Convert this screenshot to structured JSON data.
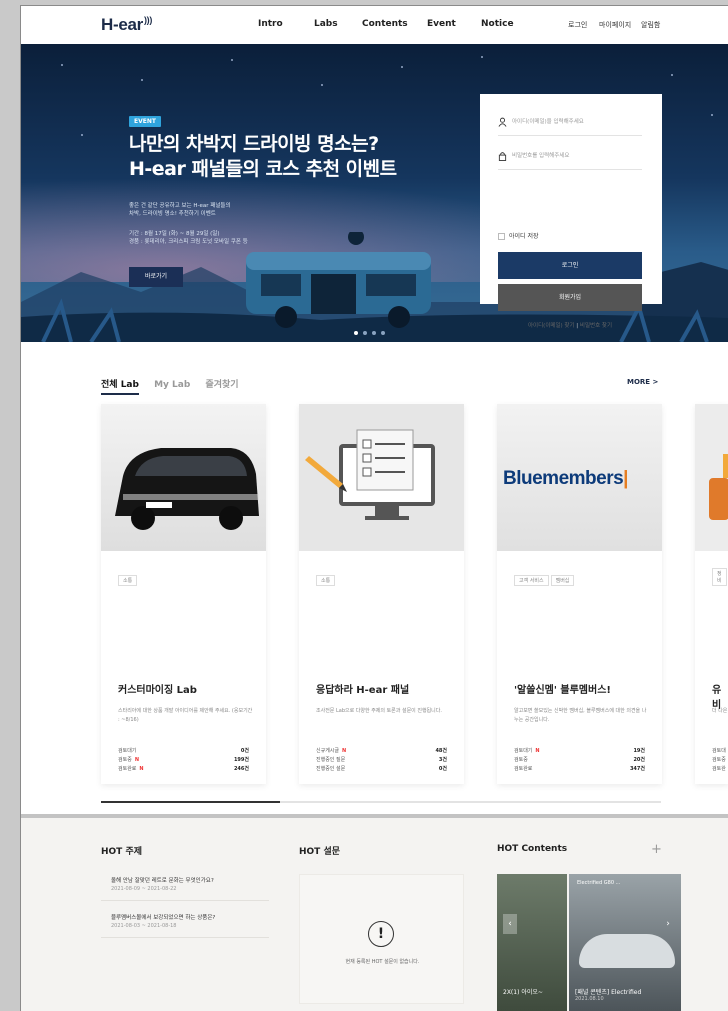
{
  "header": {
    "logo": "H-ear",
    "nav": [
      "Intro",
      "Labs",
      "Contents",
      "Event",
      "Notice"
    ],
    "util": [
      "로그인",
      "마이페이지",
      "알림함"
    ]
  },
  "hero": {
    "badge": "EVENT",
    "title_line1": "나만의 차박지 드라이빙 명소는?",
    "title_line2": "H-ear 패널들의 코스 추천 이벤트",
    "desc_line1": "좋은 건 같단 공유하고 보는 H-ear 패널들의",
    "desc_line2": "차박, 드라이빙 명소! 추천하기 이벤트",
    "period": "기간 : 8월 17일 (화) ~ 8월 29일 (일)",
    "prize": "경품 : 롯데리아, 크리스피 크림 도넛 모바일 쿠폰 등",
    "button": "바로가기",
    "slides": 4,
    "active_slide": 0
  },
  "login": {
    "id_placeholder": "아이디(이메일)을 입력해주세요",
    "pw_placeholder": "비밀번호를 입력해주세요",
    "remember": "아이디 저장",
    "login_button": "로그인",
    "join_button": "회원가입",
    "find_id": "아이디(이메일) 찾기",
    "find_pw": "비밀번호 찾기",
    "primary_color": "#1b3a66",
    "secondary_color": "#555555"
  },
  "labs": {
    "tabs": [
      "전체 Lab",
      "My Lab",
      "즐겨찾기"
    ],
    "active_tab": 0,
    "more": "MORE >",
    "cards": [
      {
        "tags": [
          "소통"
        ],
        "title": "커스터마이징 Lab",
        "desc": "스타리아에 대한 상품 개발 아이디어를 제안해 주세요. (응모기간 : ~8/16)",
        "stats": [
          {
            "label": "검토대기",
            "new": false,
            "value": "0건"
          },
          {
            "label": "검토중",
            "new": true,
            "value": "199건"
          },
          {
            "label": "검토완료",
            "new": true,
            "value": "246건"
          }
        ]
      },
      {
        "tags": [
          "소통"
        ],
        "title": "응답하라 H-ear 패널",
        "desc": "조사전문 Lab으로 다양한 주제의 토론과 설문이 진행됩니다.",
        "stats": [
          {
            "label": "신규게시글",
            "new": true,
            "value": "48건"
          },
          {
            "label": "진행중인 질문",
            "new": false,
            "value": "3건"
          },
          {
            "label": "진행중인 설문",
            "new": false,
            "value": "0건"
          }
        ]
      },
      {
        "tags": [
          "고객 서비스",
          "멤버십"
        ],
        "title": "'알쓸신멤' 블루멤버스!",
        "desc": "알고보면 쓸모있는 신박한 멤버십, 블루멤버스에 대한 의견을 나누는 공간입니다.",
        "stats": [
          {
            "label": "검토대기",
            "new": true,
            "value": "19건"
          },
          {
            "label": "검토중",
            "new": false,
            "value": "20건"
          },
          {
            "label": "검토완료",
            "new": false,
            "value": "347건"
          }
        ]
      },
      {
        "tags": [
          "정비"
        ],
        "title": "유비",
        "desc": "더 나은 ... 들의 ...",
        "stats": [
          {
            "label": "검토대",
            "new": false,
            "value": ""
          },
          {
            "label": "검토중",
            "new": false,
            "value": ""
          },
          {
            "label": "검토완",
            "new": false,
            "value": ""
          }
        ]
      }
    ],
    "bluemembers_logo": "Bluemembers",
    "scroll_progress": 0.32
  },
  "hot": {
    "topics_title": "HOT 주제",
    "topics": [
      {
        "q": "올해 안남 잘맞던 레트로 문화는 무엇인가요?",
        "d": "2021-08-09 ~ 2021-08-22"
      },
      {
        "q": "블루멤버스몰에서 보강되었으면 하는 상품은?",
        "d": "2021-08-03 ~ 2021-08-18"
      }
    ],
    "survey_title": "HOT 설문",
    "survey_empty": "현재 등록된 HOT 설문이 없습니다.",
    "contents_title": "HOT Contents",
    "contents_plus": "+",
    "contents": [
      {
        "caption": "2X(1) 아이오~",
        "date": ""
      },
      {
        "caption": "[패널 콘텐츠] Electrified",
        "date": "2021.08.10"
      }
    ],
    "contents_overlay": "Electrified G80 ..."
  }
}
